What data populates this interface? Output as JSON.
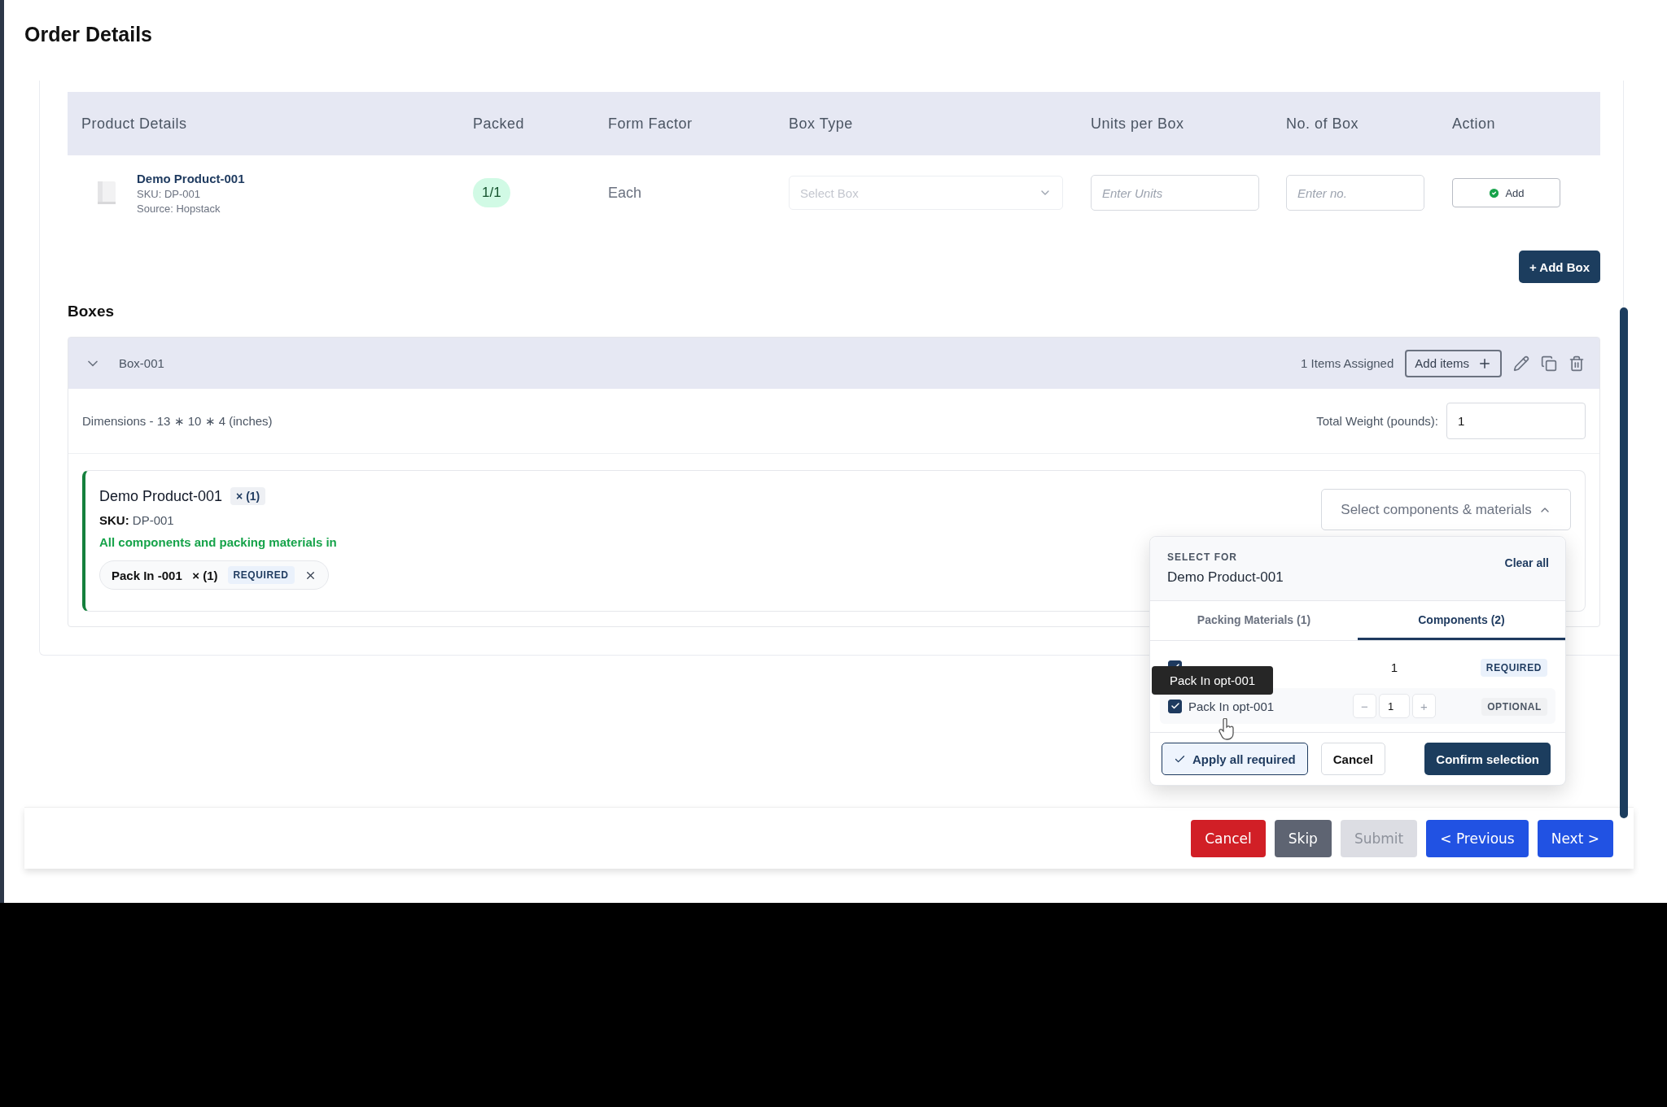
{
  "page": {
    "title": "Order Details"
  },
  "product_table": {
    "columns": [
      "Product Details",
      "Packed",
      "Form Factor",
      "Box Type",
      "Units per Box",
      "No. of Box",
      "Action"
    ],
    "rows": [
      {
        "name": "Demo Product-001",
        "sku": "SKU: DP-001",
        "source": "Source: Hopstack",
        "packed": "1/1",
        "form_factor": "Each",
        "box_type": {
          "placeholder": "Select Box"
        },
        "units_per_box": {
          "placeholder": "Enter Units"
        },
        "no_of_box": {
          "placeholder": "Enter no."
        },
        "action": "Add"
      }
    ]
  },
  "add_box_button": "+ Add Box",
  "boxes": {
    "title": "Boxes",
    "items": [
      {
        "name": "Box-001",
        "expanded": true,
        "assigned": "1 Items Assigned",
        "add_items": "Add items",
        "dimensions": "Dimensions - 13 ∗ 10 ∗ 4 (inches)",
        "weight_label": "Total Weight (pounds):",
        "weight_value": "1",
        "products": [
          {
            "name": "Demo Product-001",
            "quantity": "× (1)",
            "sku_label": "SKU:",
            "sku": "DP-001",
            "status": "All components and packing materials in",
            "chips": [
              {
                "name": "Pack In -001",
                "quantity": "× (1)",
                "badge": "REQUIRED"
              }
            ],
            "selector": {
              "label": "Select components & materials",
              "expanded": true
            }
          }
        ]
      }
    ]
  },
  "popup": {
    "select_for_label": "SELECT FOR",
    "product": "Demo Product-001",
    "clear_all": "Clear all",
    "tabs": [
      {
        "label": "Packing Materials (1)",
        "selected": false
      },
      {
        "label": "Components (2)",
        "selected": true
      }
    ],
    "items": [
      {
        "kind": "fixed",
        "checked": true,
        "quantity": "1",
        "badge": "REQUIRED"
      },
      {
        "kind": "stepper",
        "label": "Pack In opt-001",
        "checked": true,
        "decrement": "−",
        "quantity": "1",
        "increment": "+",
        "badge": "OPTIONAL"
      }
    ],
    "tooltip": "Pack In opt-001",
    "apply_all": "Apply all required",
    "cancel": "Cancel",
    "confirm": "Confirm selection"
  },
  "footer": {
    "buttons": [
      {
        "label": "Cancel",
        "kind": "danger",
        "disabled": false
      },
      {
        "label": "Skip",
        "kind": "secondary",
        "disabled": false
      },
      {
        "label": "Submit",
        "kind": "primary",
        "disabled": true
      },
      {
        "label": "< Previous",
        "kind": "primary",
        "disabled": false
      },
      {
        "label": "Next >",
        "kind": "primary",
        "disabled": false
      }
    ]
  }
}
